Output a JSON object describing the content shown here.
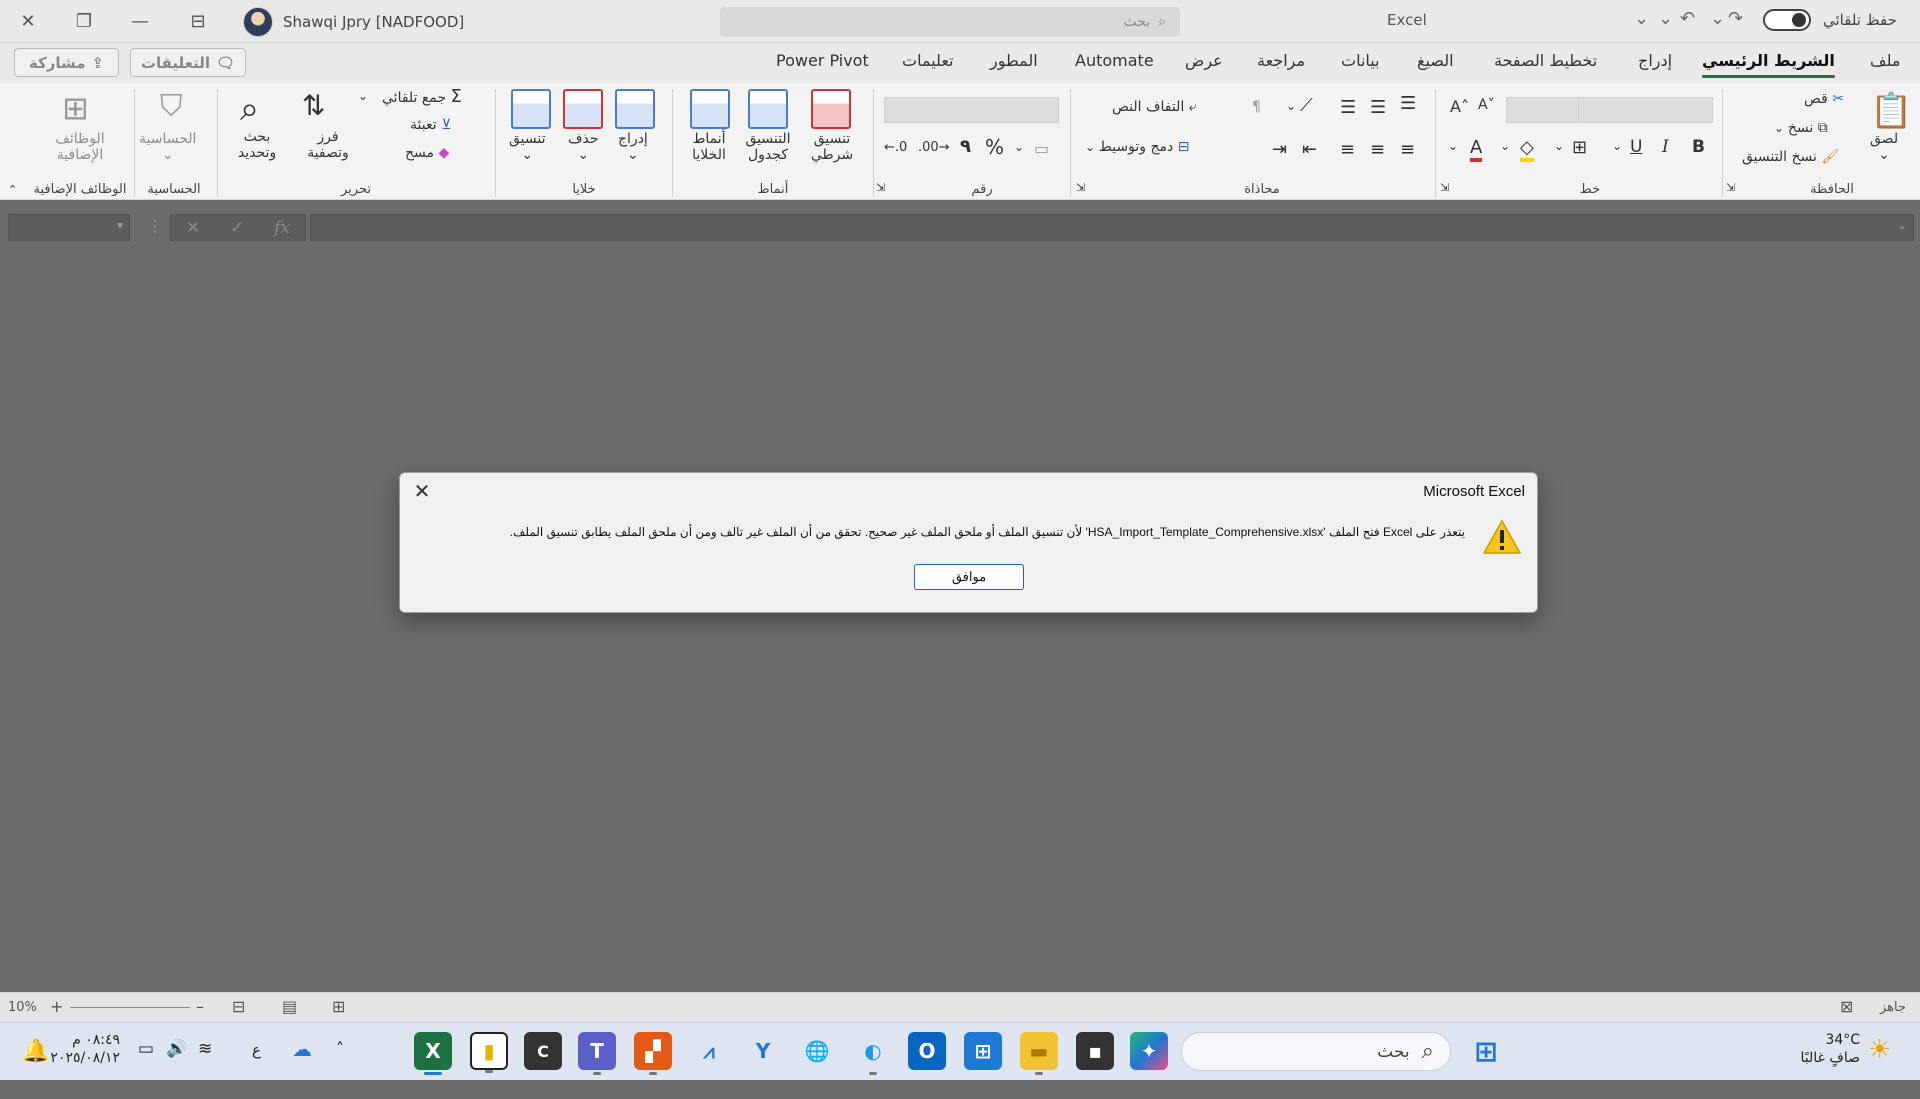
{
  "titlebar": {
    "user_name": "Shawqi Jpry [NADFOOD]",
    "search_placeholder": "بحث",
    "app_name": "Excel",
    "autosave_label": "حفظ تلقائي"
  },
  "menu": {
    "tabs": [
      "ملف",
      "الشريط الرئيسي",
      "إدراج",
      "تخطيط الصفحة",
      "الصيغ",
      "بيانات",
      "مراجعة",
      "عرض",
      "Automate",
      "المطور",
      "تعليمات",
      "Power Pivot"
    ],
    "comments_label": "التعليقات",
    "share_label": "مشاركة"
  },
  "ribbon": {
    "clipboard": {
      "paste": "لصق",
      "cut": "قص",
      "copy": "نسخ",
      "format_painter": "نسخ التنسيق",
      "label": "الحافظة"
    },
    "font": {
      "bold": "B",
      "italic": "I",
      "underline": "U",
      "label": "خط"
    },
    "alignment": {
      "wrap_text": "التفاف النص",
      "merge_center": "دمج وتوسيط",
      "label": "محاذاة"
    },
    "number": {
      "percent": "%",
      "comma": "٩",
      "label": "رقم"
    },
    "styles": {
      "conditional": "تنسيق شرطي",
      "format_table": "التنسيق كجدول",
      "cell_styles": "أنماط الخلايا",
      "label": "أنماط"
    },
    "cells": {
      "insert": "إدراج",
      "delete": "حذف",
      "format": "تنسيق",
      "label": "خلايا"
    },
    "editing": {
      "autosum": "جمع تلقائي",
      "fill": "تعبئة",
      "clear": "مسح",
      "sort_filter": "فرز وتصفية",
      "find_select": "بحث وتحديد",
      "label": "تحرير"
    },
    "sensitivity": {
      "button": "الحساسية",
      "label": "الحساسية"
    },
    "addins": {
      "button": "الوظائف الإضافية",
      "label": "الوظائف الإضافية"
    }
  },
  "formula_bar": {
    "fx": "fx"
  },
  "dialog": {
    "title": "Microsoft Excel",
    "message": "يتعذر على Excel فتح الملف 'HSA_Import_Template_Comprehensive.xlsx' لأن تنسيق الملف أو ملحق الملف غير صحيح. تحقق من أن الملف غير تالف ومن أن ملحق الملف يطابق تنسيق الملف.",
    "ok_label": "موافق"
  },
  "statusbar": {
    "ready": "جاهز",
    "zoom": "10%"
  },
  "taskbar": {
    "search_placeholder": "بحث",
    "weather_temp": "34°C",
    "weather_desc": "صافٍ غالبًا",
    "time": "٠٨:٤٩ م",
    "date": "٢٠٢٥/٠٨/١٢",
    "lang": "ع"
  },
  "colors": {
    "excel_green": "#1e7145",
    "dialog_button_border": "#2b5fb8",
    "warning_yellow": "#f5c518"
  }
}
